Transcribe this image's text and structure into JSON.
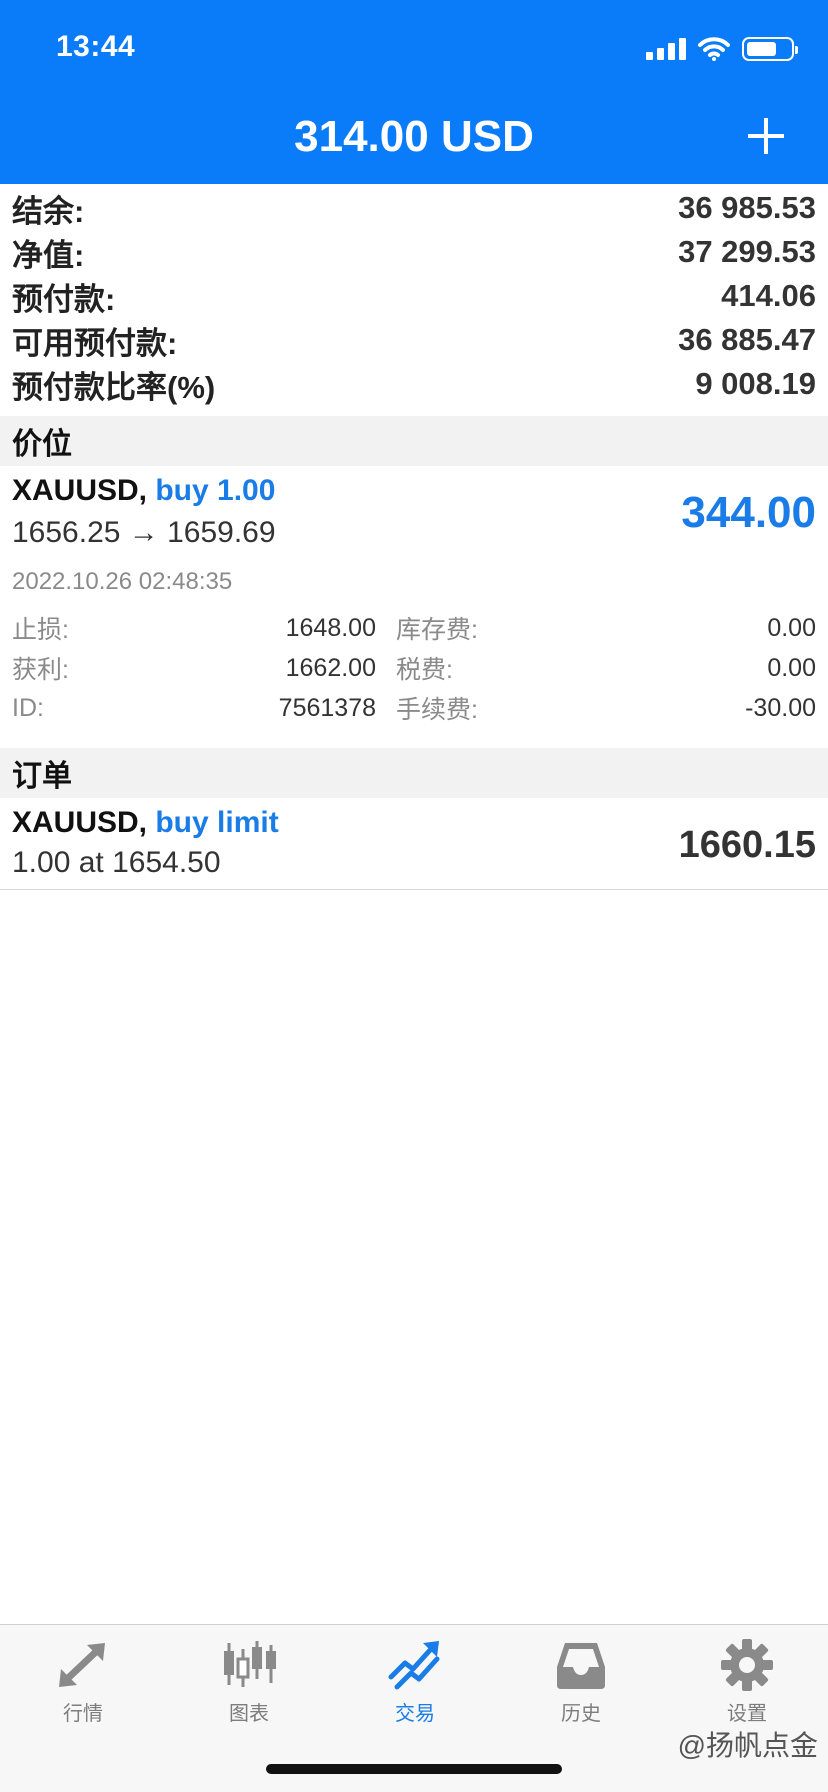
{
  "status_bar": {
    "time": "13:44"
  },
  "header": {
    "title": "314.00 USD",
    "add_icon": "plus-icon"
  },
  "summary": [
    {
      "label": "结余:",
      "value": "36 985.53"
    },
    {
      "label": "净值:",
      "value": "37 299.53"
    },
    {
      "label": "预付款:",
      "value": "414.06"
    },
    {
      "label": "可用预付款:",
      "value": "36 885.47"
    },
    {
      "label": "预付款比率(%)",
      "value": "9 008.19"
    }
  ],
  "positions_section": {
    "title": "价位"
  },
  "position": {
    "symbol": "XAUUSD,",
    "type": "buy 1.00",
    "prices": "1656.25 → 1659.69",
    "profit": "344.00",
    "time": "2022.10.26 02:48:35",
    "details": [
      {
        "label_left": "止损:",
        "value_left": "1648.00",
        "label_right": "库存费:",
        "value_right": "0.00"
      },
      {
        "label_left": "获利:",
        "value_left": "1662.00",
        "label_right": "税费:",
        "value_right": "0.00"
      },
      {
        "label_left": "ID:",
        "value_left": "7561378",
        "label_right": "手续费:",
        "value_right": "-30.00"
      }
    ]
  },
  "orders_section": {
    "title": "订单"
  },
  "order": {
    "symbol": "XAUUSD,",
    "type": "buy limit",
    "line": "1.00 at 1654.50",
    "price": "1660.15"
  },
  "tabbar": {
    "tabs": [
      {
        "label": "行情",
        "icon": "quotes-arrows-icon"
      },
      {
        "label": "图表",
        "icon": "candlestick-chart-icon"
      },
      {
        "label": "交易",
        "icon": "trade-chart-icon"
      },
      {
        "label": "历史",
        "icon": "history-tray-icon"
      },
      {
        "label": "设置",
        "icon": "gear-icon"
      }
    ],
    "active_index": 2
  },
  "watermark": "@扬帆点金",
  "colors": {
    "header_bg": "#0a7cf9",
    "accent": "#1a7ce6",
    "inactive_tab": "#7d7d7d"
  }
}
